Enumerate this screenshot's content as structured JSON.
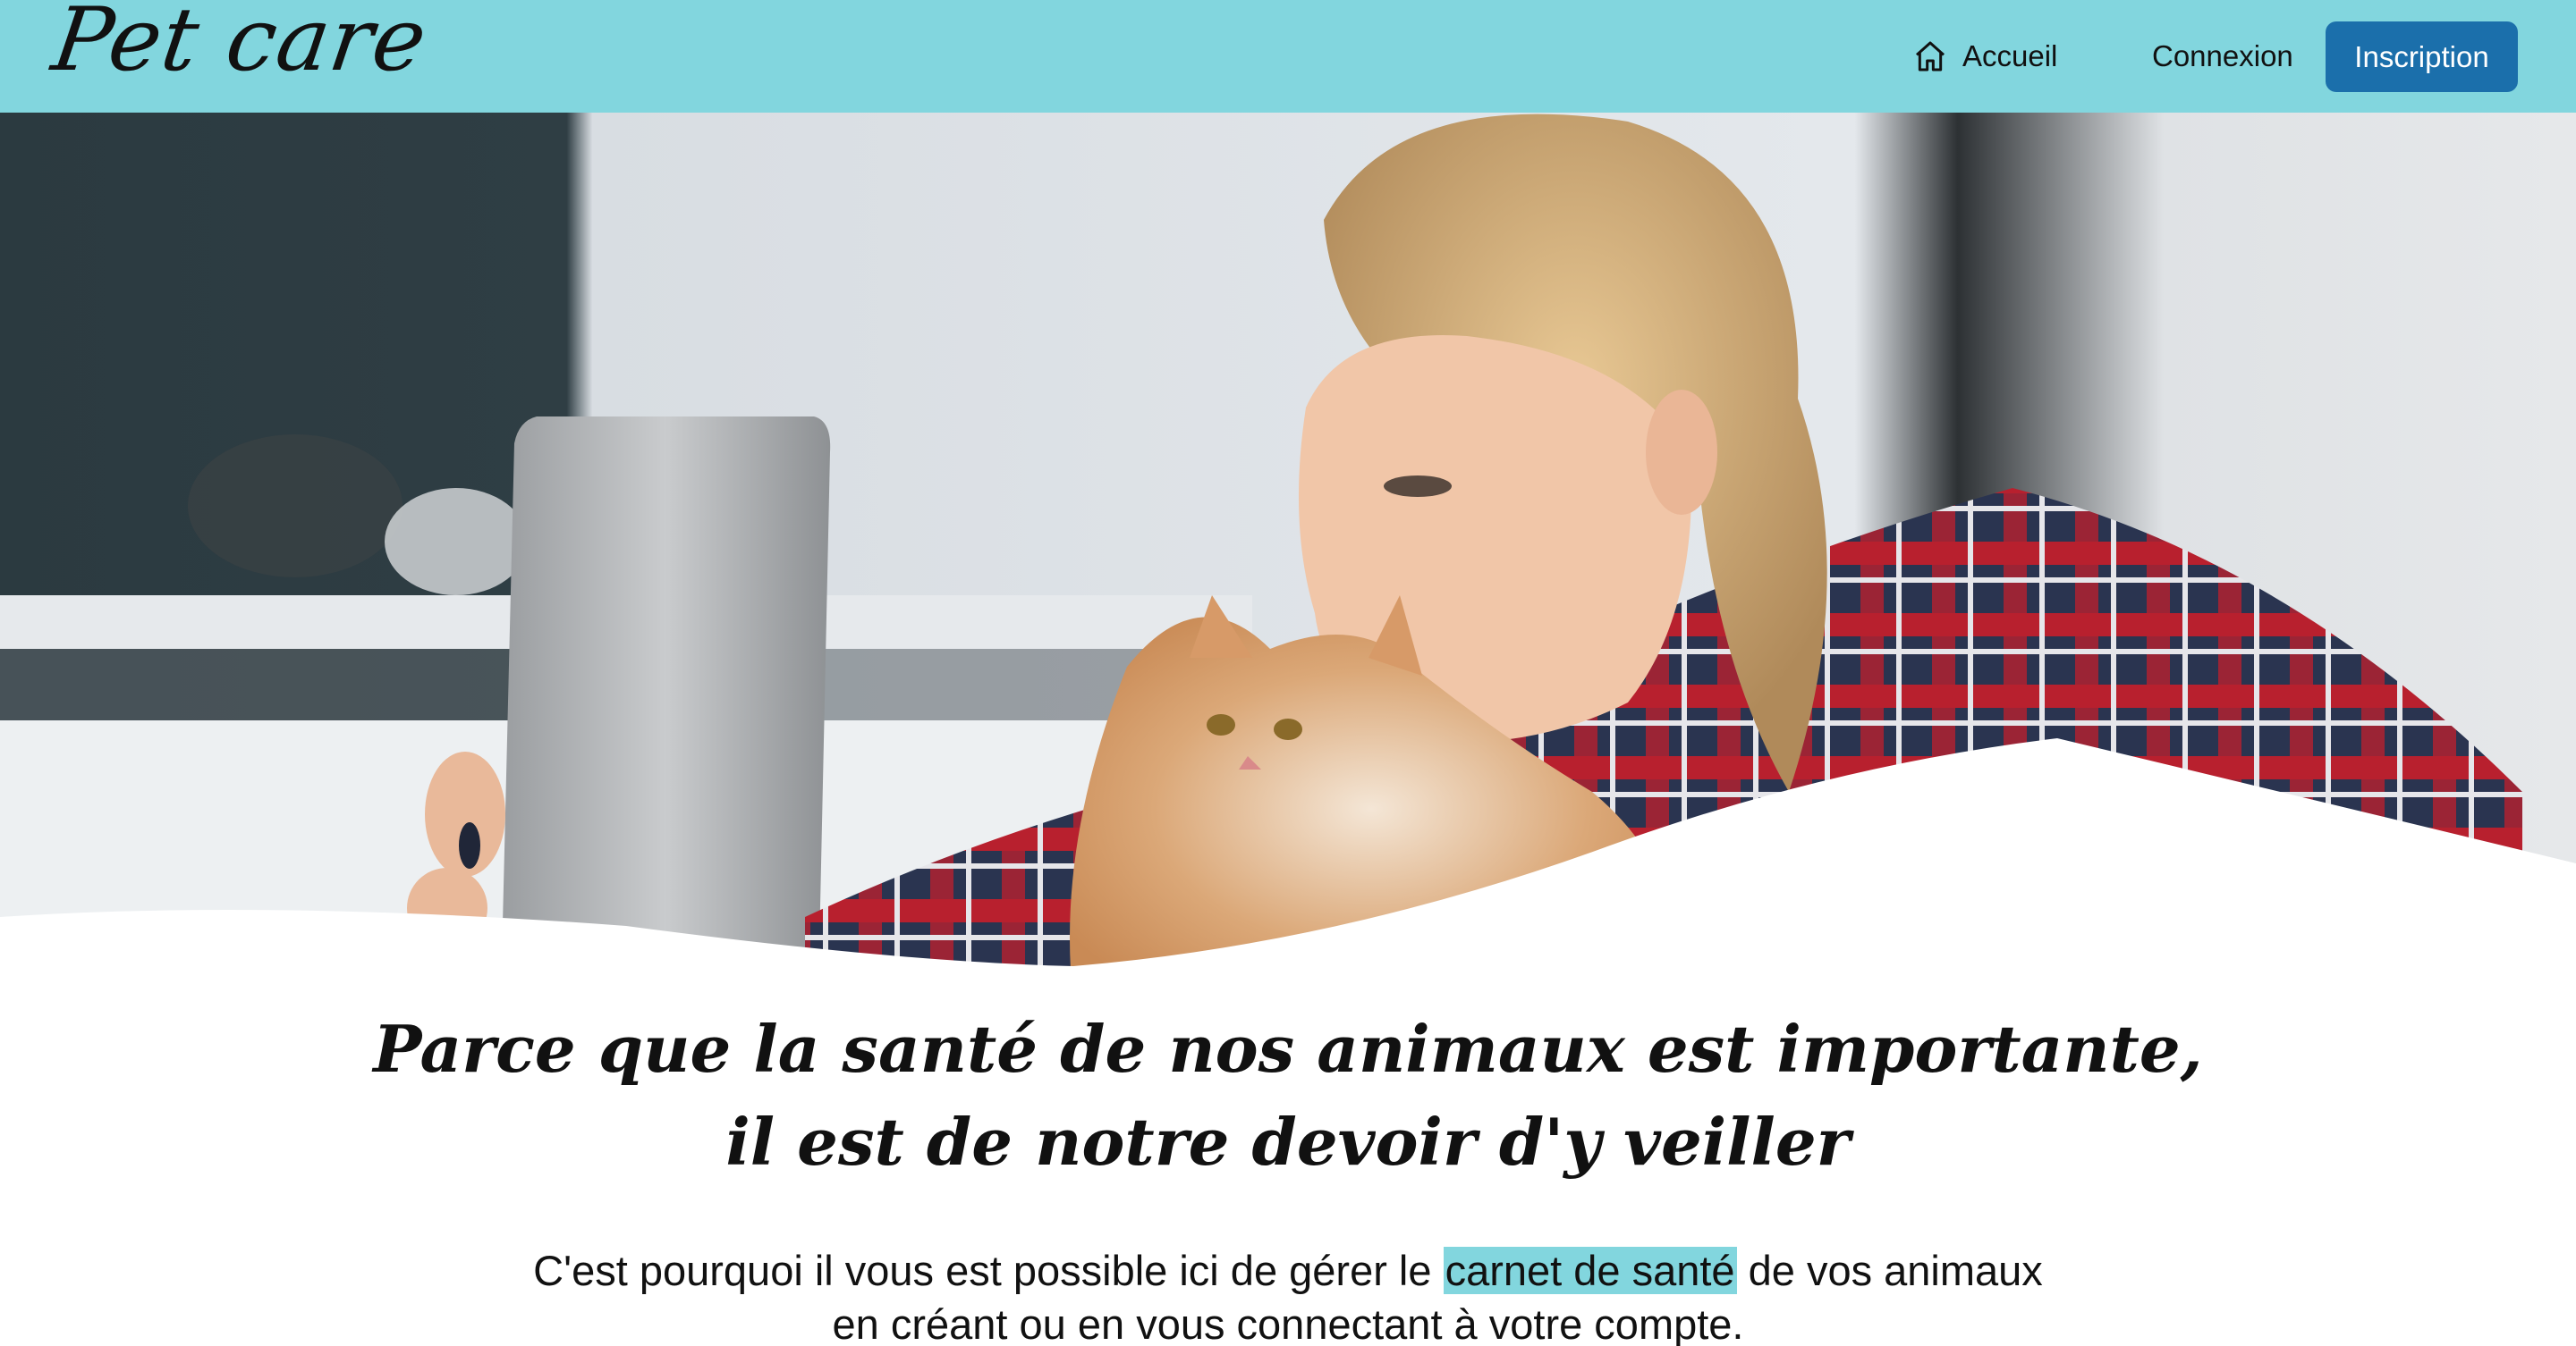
{
  "header": {
    "brand": "Pet care",
    "nav": {
      "home_label": "Accueil",
      "login_label": "Connexion",
      "signup_label": "Inscription"
    }
  },
  "hero": {
    "image_description_icon": "woman-kissing-cat-photo"
  },
  "main": {
    "tagline_line1": "Parce que la santé de nos animaux est importante,",
    "tagline_line2": "il est de notre devoir d'y veiller",
    "lead_before": "C'est pourquoi il vous est possible ici de gérer le ",
    "lead_highlight": "carnet de santé",
    "lead_after": " de vos animaux",
    "lead_line2": "en créant ou en vous connectant à votre compte."
  },
  "colors": {
    "header_bg": "#82d6de",
    "primary_button": "#1b6fab",
    "highlight": "#82d6de"
  }
}
